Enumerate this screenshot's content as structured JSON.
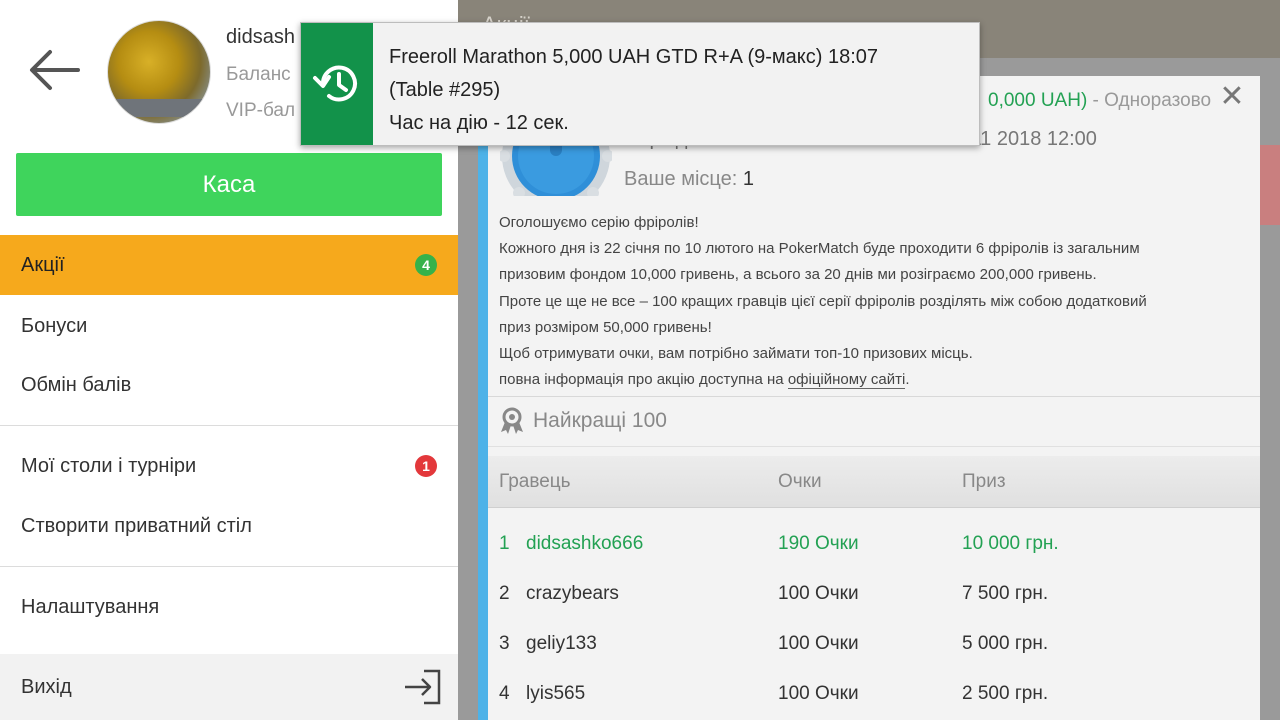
{
  "background": {
    "topbar_title": "Акції"
  },
  "drawer": {
    "user": {
      "name": "didsash",
      "balance_label": "Баланс",
      "vip_label": "VIP-бал"
    },
    "cash_button": "Каса",
    "menu": [
      {
        "label": "Акції",
        "badge": "4",
        "active": true
      },
      {
        "label": "Бонуси"
      },
      {
        "label": "Обмін балів"
      },
      {
        "label": "Мої столи і турніри",
        "badge": "1"
      },
      {
        "label": "Створити приватний стіл"
      },
      {
        "label": "Налаштування"
      },
      {
        "label": "Вихід"
      }
    ]
  },
  "promo": {
    "header_green": "0,000 UAH)",
    "header_grey": " - Одноразово",
    "period_text": "Період: січень 19 2018 00:00 - лютий 11 2018 12:00",
    "place_label": "Ваше місце: ",
    "place_value": "1",
    "description": [
      "Оголошуємо серію фріролів!",
      "Кожного дня із 22 січня по 10 лютого на PokerMatch буде проходити 6 фріролів із загальним",
      "призовим фондом 10,000 гривень, а всього за 20 днів ми розіграємо 200,000 гривень.",
      "Проте це ще не все – 100 кращих гравців цієї серії фріролів розділять між собою додатковий",
      "приз розміром 50,000 гривень!",
      "Щоб отримувати очки, вам потрібно займати топ-10 призових місць."
    ],
    "last_line_text": "повна інформація про акцію доступна на ",
    "last_line_link": "офіційному сайті",
    "last_line_end": ".",
    "leaderboard_title": "Найкращі 100",
    "columns": {
      "player": "Гравець",
      "points": "Очки",
      "prize": "Приз"
    },
    "rows": [
      {
        "rank": "1",
        "player": "didsashko666",
        "points": "190 Очки",
        "prize": "10 000 грн.",
        "me": true
      },
      {
        "rank": "2",
        "player": "crazybears",
        "points": "100 Очки",
        "prize": "7 500 грн."
      },
      {
        "rank": "3",
        "player": "geliy133",
        "points": "100 Очки",
        "prize": "5 000 грн."
      },
      {
        "rank": "4",
        "player": "lyis565",
        "points": "100 Очки",
        "prize": "2 500 грн."
      }
    ]
  },
  "toast": {
    "line1": "Freeroll Marathon 5,000 UAH GTD R+A (9-макс) 18:07",
    "line2": "(Table #295)",
    "line3": "Час на дію - 12 сек."
  },
  "colors": {
    "accent_orange": "#f6a91c",
    "cash_green": "#3fd45c",
    "panel_blue_border": "#4db2e8",
    "me_green": "#23a153",
    "toast_green": "#12924a"
  }
}
